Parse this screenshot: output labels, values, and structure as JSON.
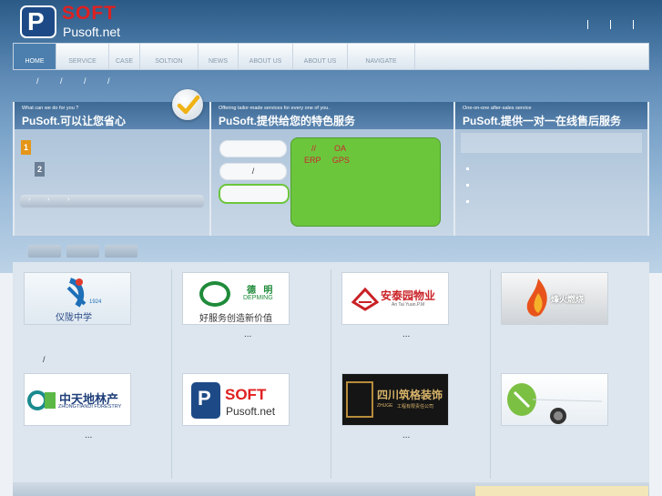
{
  "logo": {
    "letter": "P",
    "brand": "SOFT",
    "url": "Pusoft.net"
  },
  "nav": {
    "items": [
      "HOME",
      "SERVICE",
      "CASE",
      "SOLTION",
      "NEWS",
      "ABOUT US",
      "ABOUT US",
      "NAVIGATE"
    ]
  },
  "breadcrumb": {
    "seps": [
      "/",
      "/",
      "/",
      "/"
    ]
  },
  "panel1": {
    "sub": "What can we do for you ?",
    "heading": "PuSoft.可以让您省心",
    "badge1": "1",
    "badge2": "2"
  },
  "panel2": {
    "sub": "Offering tailor-made services for every one of you.",
    "heading": "PuSoft.提供给您的特色服务",
    "pill2": "/",
    "line1": "//        OA",
    "line2": "ERP     GPS"
  },
  "panel3": {
    "sub": "One-on-one after-sales service",
    "heading": "PuSoft.提供一对一在线售后服务"
  },
  "gallery": {
    "row1_captions": [
      "",
      "...",
      "...",
      ""
    ],
    "row1_extra": "/",
    "row2_captions": [
      "...",
      "",
      "...",
      ""
    ],
    "logos": {
      "school": {
        "year": "1924",
        "name": "仪陇中学"
      },
      "deming": {
        "cn": "德   明",
        "en": "DEPMING",
        "slogan": "好服务创造新价值"
      },
      "antai": {
        "cn": "安泰园物业",
        "en": "An Tai Yuan.P.M"
      },
      "flame": {
        "cn": "烽火燃烧"
      },
      "forestry": {
        "cn": "中天地林产",
        "en": "ZHONGTIANDI FORESTRY"
      },
      "pusoft": {
        "letter": "P",
        "brand": "SOFT",
        "url": "Pusoft.net"
      },
      "zhuge": {
        "cn": "四川筑格装饰",
        "en": "ZHUGE",
        "sub": "工程有限责任公司"
      }
    }
  },
  "colors": {
    "accent": "#4c7fae",
    "brand_red": "#e02020",
    "green": "#6cc63c"
  }
}
